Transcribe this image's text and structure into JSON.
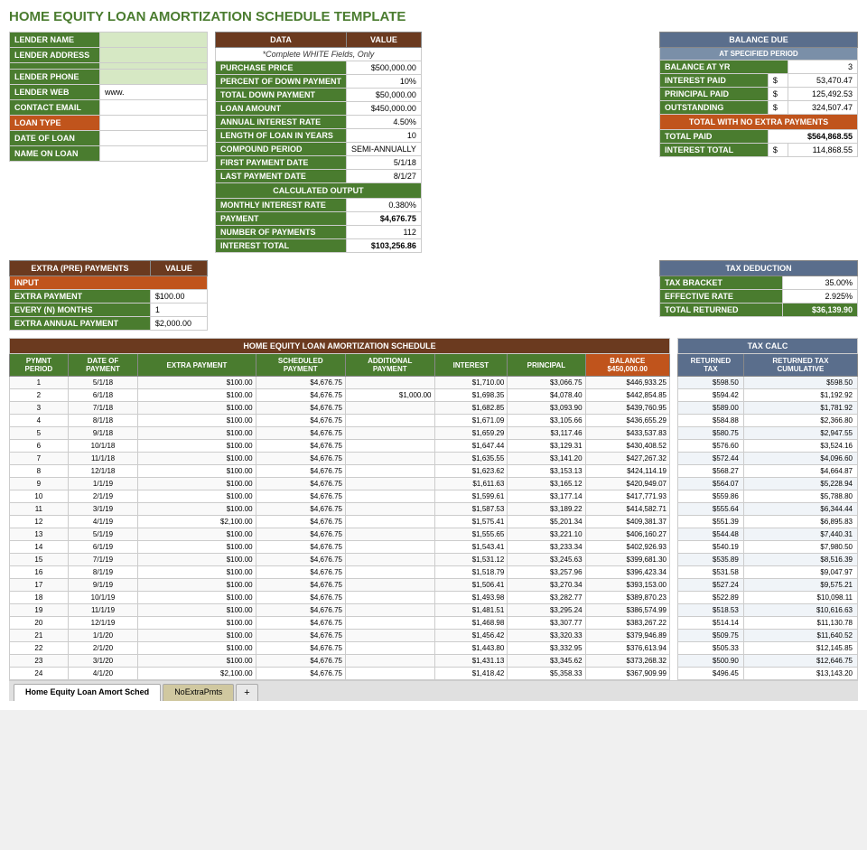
{
  "title": "HOME EQUITY LOAN AMORTIZATION SCHEDULE TEMPLATE",
  "lender": {
    "fields": [
      {
        "label": "LENDER NAME",
        "value": "",
        "type": "normal"
      },
      {
        "label": "LENDER ADDRESS",
        "value": "",
        "type": "normal"
      },
      {
        "label": "",
        "value": "",
        "type": "normal"
      },
      {
        "label": "LENDER PHONE",
        "value": "",
        "type": "normal"
      },
      {
        "label": "LENDER WEB",
        "value": "www.",
        "type": "normal"
      },
      {
        "label": "CONTACT EMAIL",
        "value": "",
        "type": "normal"
      },
      {
        "label": "LOAN TYPE",
        "value": "",
        "type": "loan"
      },
      {
        "label": "DATE OF LOAN",
        "value": "",
        "type": "normal"
      },
      {
        "label": "NAME ON LOAN",
        "value": "",
        "type": "normal"
      }
    ]
  },
  "data_table": {
    "headers": [
      "DATA",
      "VALUE"
    ],
    "note": "*Complete WHITE Fields, Only",
    "rows": [
      {
        "label": "PURCHASE PRICE",
        "value": "$500,000.00"
      },
      {
        "label": "PERCENT OF DOWN PAYMENT",
        "value": "10%"
      },
      {
        "label": "TOTAL DOWN PAYMENT",
        "value": "$50,000.00"
      },
      {
        "label": "LOAN AMOUNT",
        "value": "$450,000.00"
      },
      {
        "label": "ANNUAL INTEREST RATE",
        "value": "4.50%"
      },
      {
        "label": "LENGTH OF LOAN IN YEARS",
        "value": "10"
      },
      {
        "label": "COMPOUND PERIOD",
        "value": "SEMI-ANNUALLY"
      },
      {
        "label": "FIRST PAYMENT DATE",
        "value": "5/1/18"
      },
      {
        "label": "LAST PAYMENT DATE",
        "value": "8/1/27"
      }
    ],
    "calc_header": "CALCULATED OUTPUT",
    "calc_rows": [
      {
        "label": "MONTHLY INTEREST RATE",
        "value": "0.380%"
      },
      {
        "label": "PAYMENT",
        "value": "$4,676.75"
      },
      {
        "label": "NUMBER OF PAYMENTS",
        "value": "112"
      },
      {
        "label": "INTEREST TOTAL",
        "value": "$103,256.86"
      }
    ]
  },
  "balance_due": {
    "header": "BALANCE DUE",
    "sub_header": "AT SPECIFIED PERIOD",
    "balance_at_yr_label": "BALANCE AT YR",
    "balance_at_yr_value": "3",
    "rows": [
      {
        "label": "INTEREST PAID",
        "symbol": "$",
        "value": "53,470.47"
      },
      {
        "label": "PRINCIPAL PAID",
        "symbol": "$",
        "value": "125,492.53"
      },
      {
        "label": "OUTSTANDING",
        "symbol": "$",
        "value": "324,507.47"
      }
    ],
    "total_header": "TOTAL WITH NO EXTRA PAYMENTS",
    "total_rows": [
      {
        "label": "TOTAL PAID",
        "value": "$564,868.55"
      },
      {
        "label": "INTEREST TOTAL",
        "symbol": "$",
        "value": "114,868.55"
      }
    ]
  },
  "extra_payments": {
    "header": "EXTRA (PRE) PAYMENTS",
    "value_header": "VALUE",
    "input_label": "INPUT",
    "rows": [
      {
        "label": "EXTRA PAYMENT",
        "value": "$100.00"
      },
      {
        "label": "EVERY (N) MONTHS",
        "value": "1"
      },
      {
        "label": "EXTRA ANNUAL PAYMENT",
        "value": "$2,000.00"
      }
    ]
  },
  "tax_deduction": {
    "header": "TAX DEDUCTION",
    "rows": [
      {
        "label": "TAX BRACKET",
        "value": "35.00%"
      },
      {
        "label": "EFFECTIVE RATE",
        "value": "2.925%"
      }
    ],
    "total_label": "TOTAL RETURNED",
    "total_value": "$36,139.90"
  },
  "amort_table": {
    "main_header": "HOME EQUITY LOAN AMORTIZATION SCHEDULE",
    "headers": [
      "PYMNT PERIOD",
      "DATE OF PAYMENT",
      "EXTRA PAYMENT",
      "SCHEDULED PAYMENT",
      "ADDITIONAL PAYMENT",
      "INTEREST",
      "PRINCIPAL",
      "BALANCE $450,000.00"
    ],
    "rows": [
      [
        1,
        "5/1/18",
        "$100.00",
        "$4,676.75",
        "",
        "$1,710.00",
        "$3,066.75",
        "$446,933.25"
      ],
      [
        2,
        "6/1/18",
        "$100.00",
        "$4,676.75",
        "$1,000.00",
        "$1,698.35",
        "$4,078.40",
        "$442,854.85"
      ],
      [
        3,
        "7/1/18",
        "$100.00",
        "$4,676.75",
        "",
        "$1,682.85",
        "$3,093.90",
        "$439,760.95"
      ],
      [
        4,
        "8/1/18",
        "$100.00",
        "$4,676.75",
        "",
        "$1,671.09",
        "$3,105.66",
        "$436,655.29"
      ],
      [
        5,
        "9/1/18",
        "$100.00",
        "$4,676.75",
        "",
        "$1,659.29",
        "$3,117.46",
        "$433,537.83"
      ],
      [
        6,
        "10/1/18",
        "$100.00",
        "$4,676.75",
        "",
        "$1,647.44",
        "$3,129.31",
        "$430,408.52"
      ],
      [
        7,
        "11/1/18",
        "$100.00",
        "$4,676.75",
        "",
        "$1,635.55",
        "$3,141.20",
        "$427,267.32"
      ],
      [
        8,
        "12/1/18",
        "$100.00",
        "$4,676.75",
        "",
        "$1,623.62",
        "$3,153.13",
        "$424,114.19"
      ],
      [
        9,
        "1/1/19",
        "$100.00",
        "$4,676.75",
        "",
        "$1,611.63",
        "$3,165.12",
        "$420,949.07"
      ],
      [
        10,
        "2/1/19",
        "$100.00",
        "$4,676.75",
        "",
        "$1,599.61",
        "$3,177.14",
        "$417,771.93"
      ],
      [
        11,
        "3/1/19",
        "$100.00",
        "$4,676.75",
        "",
        "$1,587.53",
        "$3,189.22",
        "$414,582.71"
      ],
      [
        12,
        "4/1/19",
        "$2,100.00",
        "$4,676.75",
        "",
        "$1,575.41",
        "$5,201.34",
        "$409,381.37"
      ],
      [
        13,
        "5/1/19",
        "$100.00",
        "$4,676.75",
        "",
        "$1,555.65",
        "$3,221.10",
        "$406,160.27"
      ],
      [
        14,
        "6/1/19",
        "$100.00",
        "$4,676.75",
        "",
        "$1,543.41",
        "$3,233.34",
        "$402,926.93"
      ],
      [
        15,
        "7/1/19",
        "$100.00",
        "$4,676.75",
        "",
        "$1,531.12",
        "$3,245.63",
        "$399,681.30"
      ],
      [
        16,
        "8/1/19",
        "$100.00",
        "$4,676.75",
        "",
        "$1,518.79",
        "$3,257.96",
        "$396,423.34"
      ],
      [
        17,
        "9/1/19",
        "$100.00",
        "$4,676.75",
        "",
        "$1,506.41",
        "$3,270.34",
        "$393,153.00"
      ],
      [
        18,
        "10/1/19",
        "$100.00",
        "$4,676.75",
        "",
        "$1,493.98",
        "$3,282.77",
        "$389,870.23"
      ],
      [
        19,
        "11/1/19",
        "$100.00",
        "$4,676.75",
        "",
        "$1,481.51",
        "$3,295.24",
        "$386,574.99"
      ],
      [
        20,
        "12/1/19",
        "$100.00",
        "$4,676.75",
        "",
        "$1,468.98",
        "$3,307.77",
        "$383,267.22"
      ],
      [
        21,
        "1/1/20",
        "$100.00",
        "$4,676.75",
        "",
        "$1,456.42",
        "$3,320.33",
        "$379,946.89"
      ],
      [
        22,
        "2/1/20",
        "$100.00",
        "$4,676.75",
        "",
        "$1,443.80",
        "$3,332.95",
        "$376,613.94"
      ],
      [
        23,
        "3/1/20",
        "$100.00",
        "$4,676.75",
        "",
        "$1,431.13",
        "$3,345.62",
        "$373,268.32"
      ],
      [
        24,
        "4/1/20",
        "$2,100.00",
        "$4,676.75",
        "",
        "$1,418.42",
        "$5,358.33",
        "$367,909.99"
      ]
    ]
  },
  "tax_calc": {
    "main_header": "TAX CALC",
    "headers": [
      "RETURNED TAX",
      "RETURNED TAX CUMULATIVE"
    ],
    "rows": [
      [
        "$598.50",
        "$598.50"
      ],
      [
        "$594.42",
        "$1,192.92"
      ],
      [
        "$589.00",
        "$1,781.92"
      ],
      [
        "$584.88",
        "$2,366.80"
      ],
      [
        "$580.75",
        "$2,947.55"
      ],
      [
        "$576.60",
        "$3,524.16"
      ],
      [
        "$572.44",
        "$4,096.60"
      ],
      [
        "$568.27",
        "$4,664.87"
      ],
      [
        "$564.07",
        "$5,228.94"
      ],
      [
        "$559.86",
        "$5,788.80"
      ],
      [
        "$555.64",
        "$6,344.44"
      ],
      [
        "$551.39",
        "$6,895.83"
      ],
      [
        "$544.48",
        "$7,440.31"
      ],
      [
        "$540.19",
        "$7,980.50"
      ],
      [
        "$535.89",
        "$8,516.39"
      ],
      [
        "$531.58",
        "$9,047.97"
      ],
      [
        "$527.24",
        "$9,575.21"
      ],
      [
        "$522.89",
        "$10,098.11"
      ],
      [
        "$518.53",
        "$10,616.63"
      ],
      [
        "$514.14",
        "$11,130.78"
      ],
      [
        "$509.75",
        "$11,640.52"
      ],
      [
        "$505.33",
        "$12,145.85"
      ],
      [
        "$500.90",
        "$12,646.75"
      ],
      [
        "$496.45",
        "$13,143.20"
      ]
    ]
  },
  "tabs": [
    {
      "label": "Home Equity Loan Amort Sched",
      "active": true
    },
    {
      "label": "NoExtraPmts",
      "active": false
    }
  ]
}
